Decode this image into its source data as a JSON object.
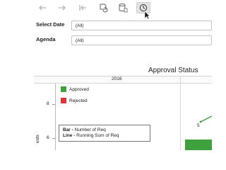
{
  "toolbar": {
    "buttons": [
      {
        "icon": "undo-arrow-icon"
      },
      {
        "icon": "redo-arrow-icon"
      },
      {
        "icon": "revert-to-start-icon"
      },
      {
        "icon": "refresh-data-icon"
      },
      {
        "icon": "data-source-icon"
      },
      {
        "icon": "clock-pause-icon"
      }
    ]
  },
  "filters": {
    "select_date": {
      "label": "Select Date",
      "value": "(All)"
    },
    "agenda": {
      "label": "Agenda",
      "value": "(All)"
    }
  },
  "viz": {
    "title": "Approval Status",
    "column_year": "2016",
    "y_ticks": [
      "8",
      "6"
    ],
    "y_axis_title": "ests",
    "legend": [
      {
        "label": "Approved",
        "color": "#3ea13d"
      },
      {
        "label": "Rejected",
        "color": "#d9353a"
      }
    ],
    "tooltip": {
      "bar_key": "Bar -",
      "bar_value": "Number of Req",
      "line_key": "Line -",
      "line_value": "Running Sum of Req"
    },
    "point_label": "5"
  }
}
